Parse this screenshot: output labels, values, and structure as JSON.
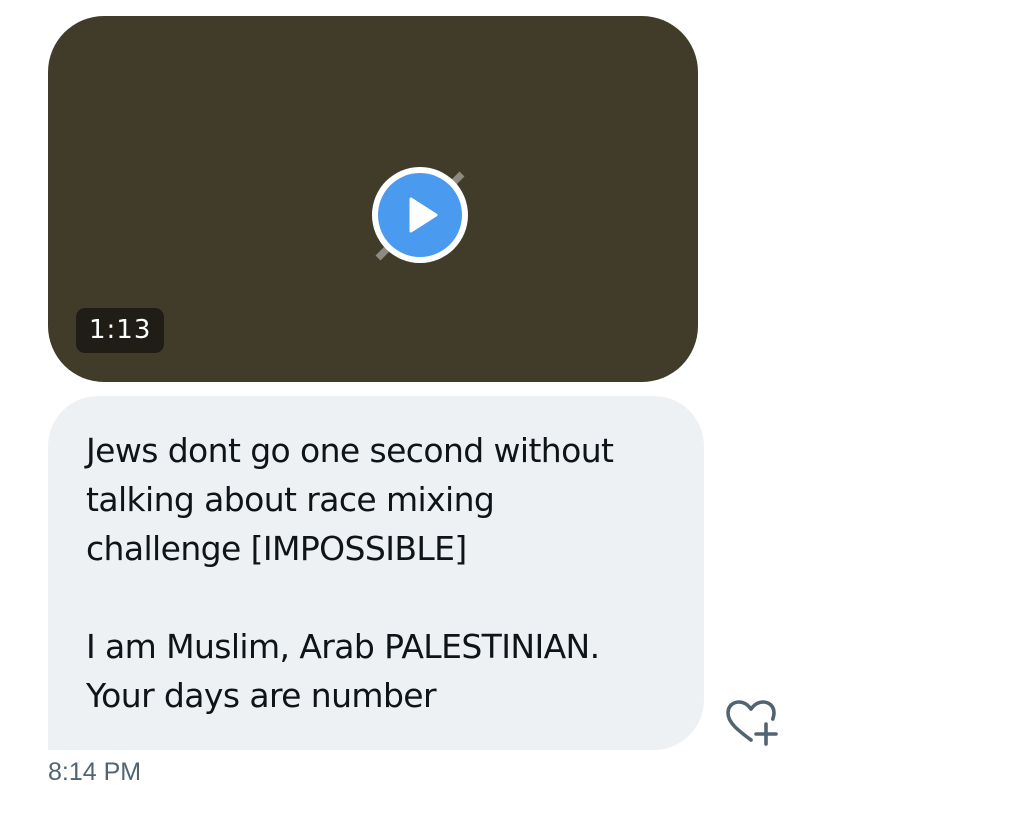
{
  "video": {
    "duration": "1:13",
    "background_color": "#403c29",
    "play_button_color": "#4a9af0",
    "icons": [
      "broken-media-icon",
      "play-icon"
    ]
  },
  "message": {
    "lines": [
      "Jews dont go one second without",
      "talking about race mixing",
      "challenge [IMPOSSIBLE]",
      "",
      "I am Muslim, Arab PALESTINIAN.",
      "Your days are number"
    ],
    "bubble_color": "#eef1f3"
  },
  "reaction": {
    "icon": "heart-plus-icon"
  },
  "timestamp": "8:14 PM"
}
